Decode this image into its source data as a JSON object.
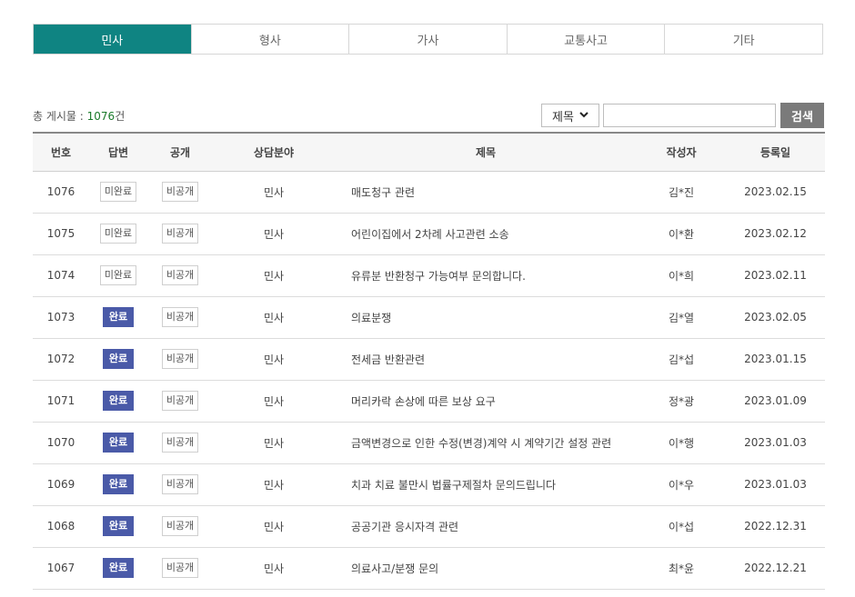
{
  "tabs": [
    {
      "label": "민사",
      "active": true
    },
    {
      "label": "형사",
      "active": false
    },
    {
      "label": "가사",
      "active": false
    },
    {
      "label": "교통사고",
      "active": false
    },
    {
      "label": "기타",
      "active": false
    }
  ],
  "summary": {
    "label": "총 게시물 : ",
    "count": "1076",
    "unit": "건"
  },
  "search": {
    "field": "제목",
    "value": "",
    "button": "검색",
    "chevron": "chevron-down-icon"
  },
  "columns": [
    "번호",
    "답변",
    "공개",
    "상담분야",
    "제목",
    "작성자",
    "등록일"
  ],
  "rows": [
    {
      "no": "1076",
      "answer": "미완료",
      "answered": false,
      "visibility": "비공개",
      "field": "민사",
      "title": "매도청구 관련",
      "author": "김*진",
      "date": "2023.02.15"
    },
    {
      "no": "1075",
      "answer": "미완료",
      "answered": false,
      "visibility": "비공개",
      "field": "민사",
      "title": "어린이집에서 2차례 사고관련 소송",
      "author": "이*환",
      "date": "2023.02.12"
    },
    {
      "no": "1074",
      "answer": "미완료",
      "answered": false,
      "visibility": "비공개",
      "field": "민사",
      "title": "유류분 반환청구 가능여부 문의합니다.",
      "author": "이*희",
      "date": "2023.02.11"
    },
    {
      "no": "1073",
      "answer": "완료",
      "answered": true,
      "visibility": "비공개",
      "field": "민사",
      "title": "의료분쟁",
      "author": "김*열",
      "date": "2023.02.05"
    },
    {
      "no": "1072",
      "answer": "완료",
      "answered": true,
      "visibility": "비공개",
      "field": "민사",
      "title": "전세금 반환관련",
      "author": "김*섭",
      "date": "2023.01.15"
    },
    {
      "no": "1071",
      "answer": "완료",
      "answered": true,
      "visibility": "비공개",
      "field": "민사",
      "title": "머리카락 손상에 따른 보상 요구",
      "author": "정*광",
      "date": "2023.01.09"
    },
    {
      "no": "1070",
      "answer": "완료",
      "answered": true,
      "visibility": "비공개",
      "field": "민사",
      "title": "금액변경으로 인한 수정(변경)계약 시 계약기간 설정 관련",
      "author": "이*행",
      "date": "2023.01.03"
    },
    {
      "no": "1069",
      "answer": "완료",
      "answered": true,
      "visibility": "비공개",
      "field": "민사",
      "title": "치과 치료 불만시 법률구제절차 문의드립니다",
      "author": "이*우",
      "date": "2023.01.03"
    },
    {
      "no": "1068",
      "answer": "완료",
      "answered": true,
      "visibility": "비공개",
      "field": "민사",
      "title": "공공기관 응시자격 관련",
      "author": "이*섭",
      "date": "2022.12.31"
    },
    {
      "no": "1067",
      "answer": "완료",
      "answered": true,
      "visibility": "비공개",
      "field": "민사",
      "title": "의료사고/분쟁 문의",
      "author": "최*윤",
      "date": "2022.12.21"
    }
  ]
}
